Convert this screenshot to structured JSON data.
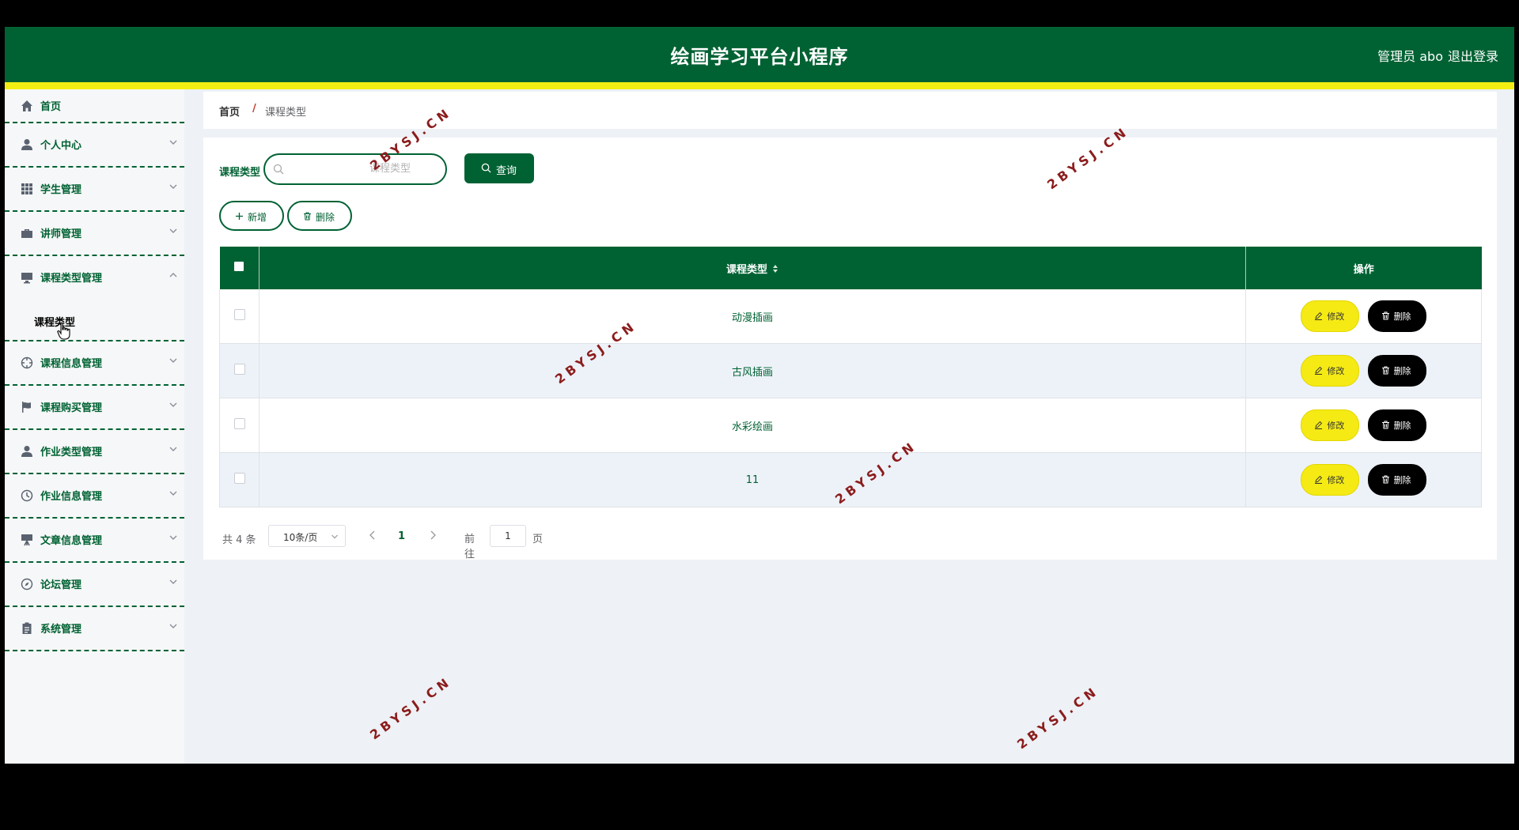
{
  "header": {
    "title": "绘画学习平台小程序",
    "user": "管理员 abo",
    "logout": "退出登录"
  },
  "sidebar": {
    "items": [
      {
        "label": "首页",
        "icon": "home-icon"
      },
      {
        "label": "个人中心",
        "icon": "user-icon"
      },
      {
        "label": "学生管理",
        "icon": "grid-icon"
      },
      {
        "label": "讲师管理",
        "icon": "briefcase-icon"
      },
      {
        "label": "课程类型管理",
        "icon": "monitor-icon",
        "expanded": true
      },
      {
        "label": "课程信息管理",
        "icon": "crosshair-icon"
      },
      {
        "label": "课程购买管理",
        "icon": "flag-icon"
      },
      {
        "label": "作业类型管理",
        "icon": "user-icon"
      },
      {
        "label": "作业信息管理",
        "icon": "clock-icon"
      },
      {
        "label": "文章信息管理",
        "icon": "easel-icon"
      },
      {
        "label": "论坛管理",
        "icon": "compass-icon"
      },
      {
        "label": "系统管理",
        "icon": "clipboard-icon"
      }
    ],
    "submenu": {
      "label": "课程类型"
    }
  },
  "breadcrumb": {
    "home": "首页",
    "separator": "/",
    "current": "课程类型"
  },
  "search": {
    "label": "课程类型",
    "placeholder": "课程类型",
    "value": "",
    "button": "查询"
  },
  "actions": {
    "add": "新增",
    "delete": "删除"
  },
  "table": {
    "columns": [
      "课程类型",
      "操作"
    ],
    "rows": [
      {
        "type": "动漫插画"
      },
      {
        "type": "古风插画"
      },
      {
        "type": "水彩绘画"
      },
      {
        "type": "11"
      }
    ],
    "edit_label": "修改",
    "delete_label": "删除"
  },
  "pagination": {
    "total": "共 4 条",
    "page_size": "10条/页",
    "current_page": "1",
    "goto_prefix": "前往",
    "goto_value": "1",
    "goto_suffix": "页"
  },
  "watermark": "2BYSJ.CN",
  "colors": {
    "primary": "#006233",
    "accent_yellow": "#f5ea14",
    "stripe": "#f2ee12",
    "row_alt": "#edf2f8"
  }
}
